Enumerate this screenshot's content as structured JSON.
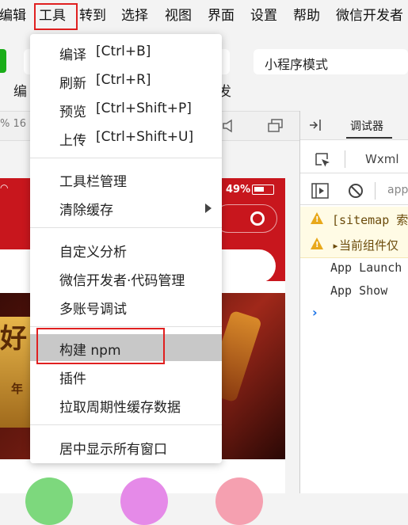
{
  "menubar": {
    "items": [
      "编辑",
      "工具",
      "转到",
      "选择",
      "视图",
      "界面",
      "设置",
      "帮助",
      "微信开发者"
    ]
  },
  "toolbar": {
    "mode": "小程序模式",
    "left_partial": "编",
    "right_partial": "发"
  },
  "simulator": {
    "zoom_partial": "% 16",
    "battery": "49%",
    "banner_text": "好",
    "banner_sub": "年"
  },
  "devtools": {
    "tab": "调试器",
    "wxml": "Wxml",
    "app_partial": "app",
    "logs": [
      {
        "level": "warning",
        "text": "[sitemap 索"
      },
      {
        "level": "warning",
        "text": "▸当前组件仅"
      },
      {
        "level": "info",
        "text": "App Launch"
      },
      {
        "level": "info",
        "text": "App Show"
      }
    ],
    "prompt": "›"
  },
  "dropdown": {
    "group1": [
      {
        "label": "编译",
        "shortcut": "[Ctrl+B]"
      },
      {
        "label": "刷新",
        "shortcut": "[Ctrl+R]"
      },
      {
        "label": "预览",
        "shortcut": "[Ctrl+Shift+P]"
      },
      {
        "label": "上传",
        "shortcut": "[Ctrl+Shift+U]"
      }
    ],
    "group2": [
      {
        "label": "工具栏管理"
      },
      {
        "label": "清除缓存",
        "submenu": true
      }
    ],
    "group3": [
      {
        "label": "自定义分析"
      },
      {
        "label": "微信开发者·代码管理"
      },
      {
        "label": "多账号调试"
      }
    ],
    "group4": [
      {
        "label": "构建 npm",
        "highlighted": true
      },
      {
        "label": "插件"
      },
      {
        "label": "拉取周期性缓存数据"
      }
    ],
    "group5": [
      {
        "label": "居中显示所有窗口"
      }
    ]
  },
  "colors": {
    "accent_red": "#c8161d",
    "highlight_box": "#e02020",
    "menu_hover": "#c8c8c8"
  }
}
